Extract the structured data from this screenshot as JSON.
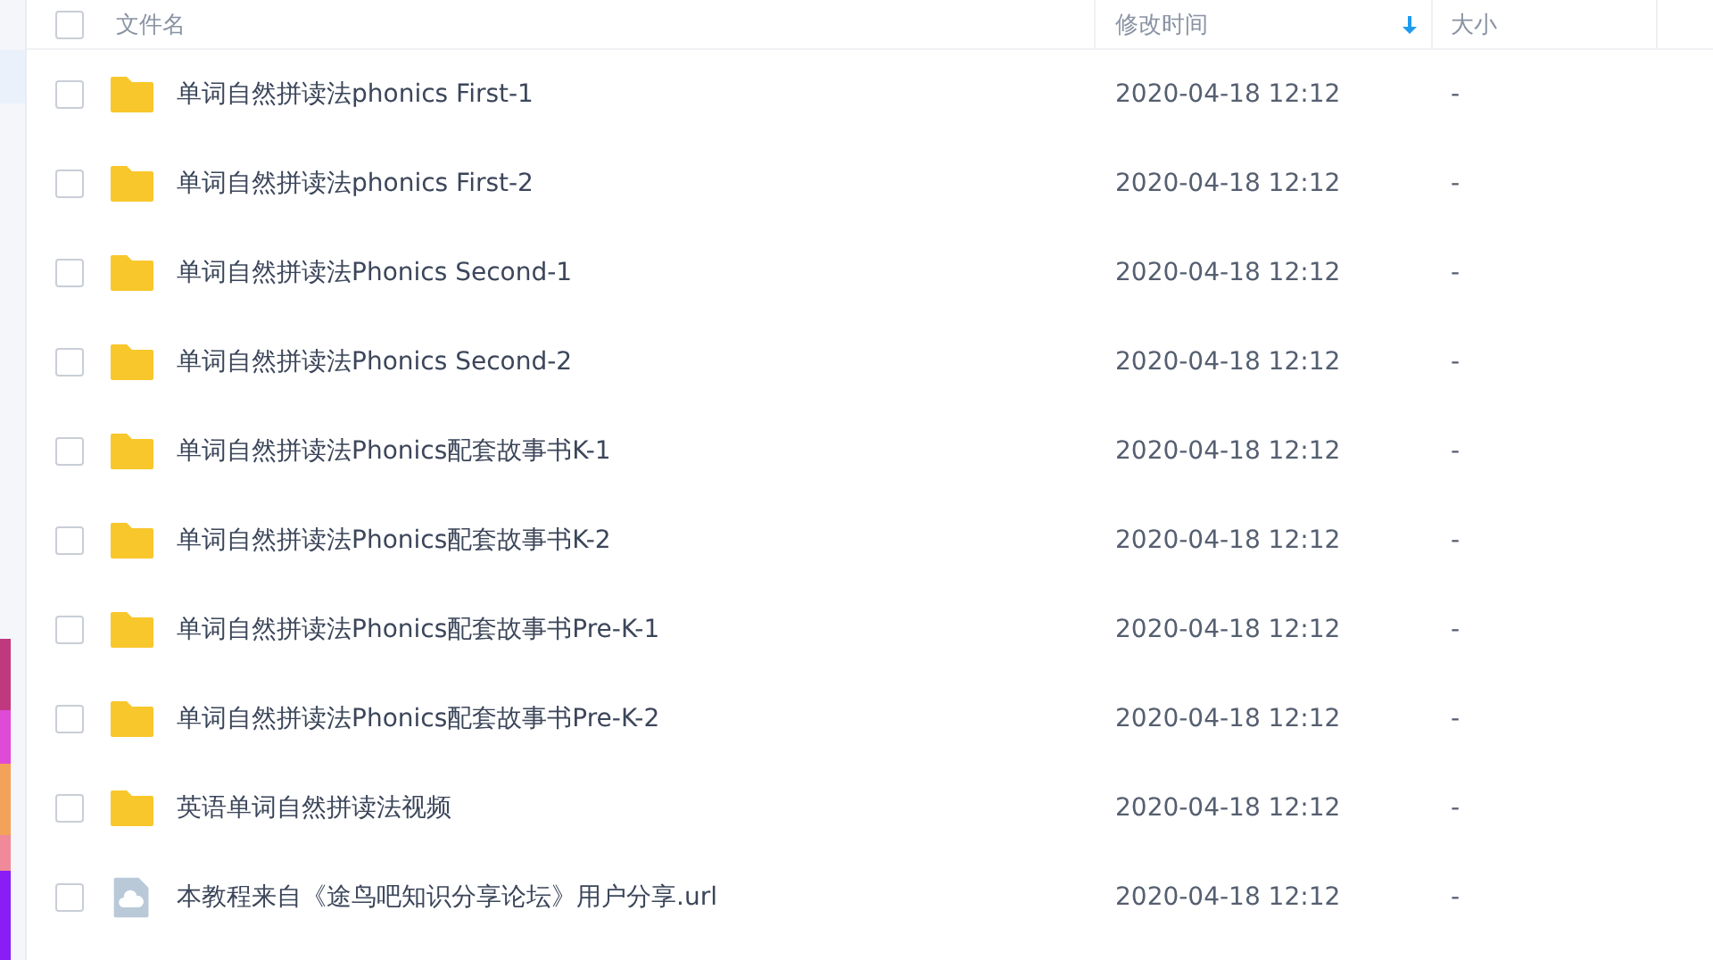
{
  "table": {
    "columns": [
      {
        "label": "文件名"
      },
      {
        "label": "修改时间",
        "sorted": true
      },
      {
        "label": "大小"
      }
    ],
    "select_all": {
      "checked": false
    },
    "rows": [
      {
        "kind": "folder",
        "name": "单词自然拼读法phonics First-1",
        "modified": "2020-04-18 12:12",
        "size": "-",
        "checked": false
      },
      {
        "kind": "folder",
        "name": "单词自然拼读法phonics First-2",
        "modified": "2020-04-18 12:12",
        "size": "-",
        "checked": false
      },
      {
        "kind": "folder",
        "name": "单词自然拼读法Phonics Second-1",
        "modified": "2020-04-18 12:12",
        "size": "-",
        "checked": false
      },
      {
        "kind": "folder",
        "name": "单词自然拼读法Phonics Second-2",
        "modified": "2020-04-18 12:12",
        "size": "-",
        "checked": false
      },
      {
        "kind": "folder",
        "name": "单词自然拼读法Phonics配套故事书K-1",
        "modified": "2020-04-18 12:12",
        "size": "-",
        "checked": false
      },
      {
        "kind": "folder",
        "name": "单词自然拼读法Phonics配套故事书K-2",
        "modified": "2020-04-18 12:12",
        "size": "-",
        "checked": false
      },
      {
        "kind": "folder",
        "name": "单词自然拼读法Phonics配套故事书Pre-K-1",
        "modified": "2020-04-18 12:12",
        "size": "-",
        "checked": false
      },
      {
        "kind": "folder",
        "name": "单词自然拼读法Phonics配套故事书Pre-K-2",
        "modified": "2020-04-18 12:12",
        "size": "-",
        "checked": false
      },
      {
        "kind": "folder",
        "name": "英语单词自然拼读法视频",
        "modified": "2020-04-18 12:12",
        "size": "-",
        "checked": false
      },
      {
        "kind": "link",
        "name": "本教程来自《途鸟吧知识分享论坛》用户分享.url",
        "modified": "2020-04-18 12:12",
        "size": "-",
        "checked": false
      }
    ]
  }
}
